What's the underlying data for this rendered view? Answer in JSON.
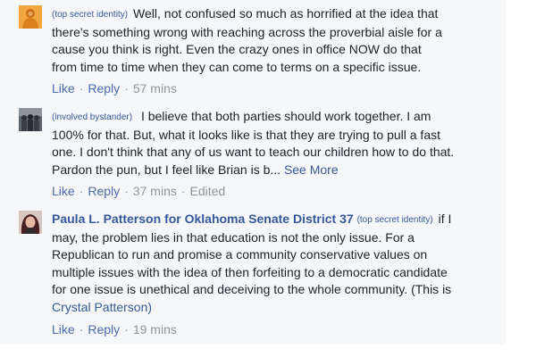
{
  "comments": [
    {
      "identity_tag": "(top secret identity)",
      "lines": [
        "Well, not confused so much as horrified at the idea that",
        "there's something wrong with reaching across the proverbial aisle for a",
        "cause you think is right. Even the crazy ones in office NOW do that",
        "from time to time when they can come to terms on a specific issue."
      ],
      "like": "Like",
      "reply": "Reply",
      "time": "57 mins"
    },
    {
      "identity_tag": "(involved bystander)",
      "lines": [
        "I believe that both parties should work together. I am",
        "100% for that. But, what it looks like is that they are trying to pull a fast",
        "one. I don't think that any of us want to teach our children how to do that.",
        "Pardon the pun, but I feel like Brian is b..."
      ],
      "see_more": "See More",
      "like": "Like",
      "reply": "Reply",
      "time": "37 mins",
      "edited": "Edited"
    },
    {
      "author": "Paula L. Patterson for Oklahoma Senate District 37",
      "identity_tag": "(top secret identity)",
      "lines": [
        "if I",
        "may, the problem lies in that education is not the only issue. For a",
        "Republican to run and promise a community conservative values on",
        "multiple issues with the idea of then forfeiting to a democratic candidate",
        "for one issue is unethical and deceiving to the whole community. (This is"
      ],
      "mention": "Crystal Patterson)",
      "like": "Like",
      "reply": "Reply",
      "time": "19 mins"
    }
  ]
}
